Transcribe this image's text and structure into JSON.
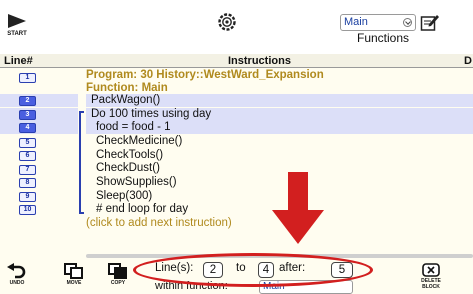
{
  "toolbar": {
    "start_label": "START",
    "function_select_value": "Main",
    "functions_label": "Functions"
  },
  "header": {
    "line_col": "Line#",
    "instructions_col": "Instructions",
    "clipped_col": "D"
  },
  "program": {
    "program_line": "Program: 30 History::WestWard_Expansion",
    "function_line": "Function: Main"
  },
  "rows": [
    {
      "line": "1",
      "text": ""
    },
    {
      "line": "2",
      "text": "PackWagon()"
    },
    {
      "line": "3",
      "text": "Do 100 times using day"
    },
    {
      "line": "4",
      "text": "food = food - 1"
    },
    {
      "line": "5",
      "text": "CheckMedicine()"
    },
    {
      "line": "6",
      "text": "CheckTools()"
    },
    {
      "line": "7",
      "text": "CheckDust()"
    },
    {
      "line": "8",
      "text": "ShowSupplies()"
    },
    {
      "line": "9",
      "text": "Sleep(300)"
    },
    {
      "line": "10",
      "text": "# end loop for day"
    }
  ],
  "add_next": "(click to add next instruction)",
  "bottom": {
    "undo_label": "UNDO",
    "move_label": "MOVE",
    "copy_label": "COPY",
    "delete_label": "DELETE BLOCK",
    "lines_label": "Line(s):",
    "from_value": "2",
    "to_label": "to",
    "to_value": "4",
    "after_label": "after:",
    "after_value": "5",
    "within_label": "within function:",
    "within_value": "Main"
  },
  "colors": {
    "accent_blue": "#2a3fb0",
    "selection": "#dcdff8",
    "program_gold": "#b08a1e",
    "annotation_red": "#d21f1f"
  }
}
